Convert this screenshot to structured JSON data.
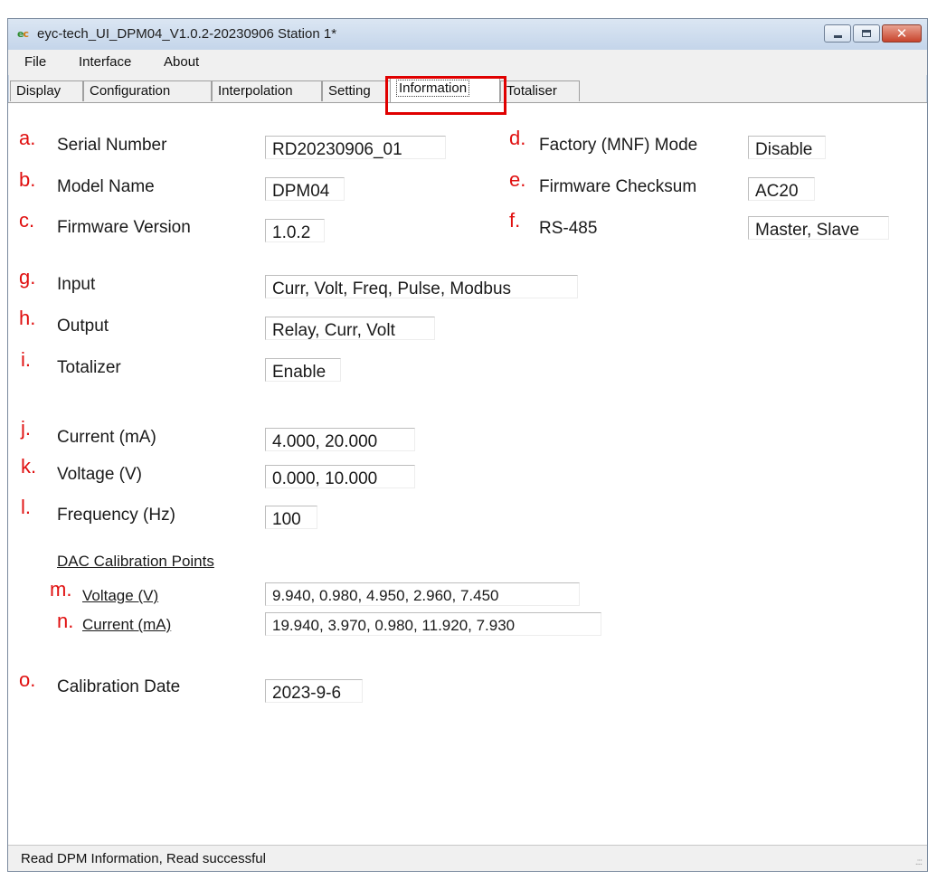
{
  "window": {
    "title": "eyc-tech_UI_DPM04_V1.0.2-20230906  Station 1*",
    "icon_text_1": "e",
    "icon_text_2": "c"
  },
  "menu": [
    "File",
    "Interface",
    "About"
  ],
  "tabs": [
    "Display",
    "Configuration",
    "Interpolation",
    "Setting",
    "Information",
    "Totaliser"
  ],
  "active_tab": "Information",
  "info": {
    "a": {
      "letter": "a.",
      "label": "Serial Number",
      "value": "RD20230906_01"
    },
    "b": {
      "letter": "b.",
      "label": "Model Name",
      "value": "DPM04"
    },
    "c": {
      "letter": "c.",
      "label": "Firmware Version",
      "value": "1.0.2"
    },
    "d": {
      "letter": "d.",
      "label": "Factory (MNF) Mode",
      "value": "Disable"
    },
    "e": {
      "letter": "e.",
      "label": "Firmware Checksum",
      "value": "AC20"
    },
    "f": {
      "letter": "f.",
      "label": "RS-485",
      "value": "Master, Slave"
    },
    "g": {
      "letter": "g.",
      "label": "Input",
      "value": "Curr, Volt, Freq, Pulse, Modbus"
    },
    "h": {
      "letter": "h.",
      "label": "Output",
      "value": "Relay, Curr, Volt"
    },
    "i": {
      "letter": "i.",
      "label": "Totalizer",
      "value": "Enable"
    },
    "j": {
      "letter": "j.",
      "label": "Current (mA)",
      "value": "4.000, 20.000"
    },
    "k": {
      "letter": "k.",
      "label": "Voltage (V)",
      "value": "0.000, 10.000"
    },
    "l": {
      "letter": "l.",
      "label": "Frequency (Hz)",
      "value": "100"
    },
    "dac_heading": "DAC Calibration Points",
    "m": {
      "letter": "m.",
      "label": "Voltage (V)",
      "value": "9.940, 0.980, 4.950, 2.960, 7.450"
    },
    "n": {
      "letter": "n.",
      "label": "Current (mA)",
      "value": "19.940, 3.970, 0.980, 11.920, 7.930"
    },
    "o": {
      "letter": "o.",
      "label": "Calibration Date",
      "value": "2023-9-6"
    }
  },
  "status": {
    "text": "Read DPM Information,   Read successful"
  },
  "colors": {
    "annotation_red": "#e01010",
    "highlight_red": "#e00000"
  }
}
